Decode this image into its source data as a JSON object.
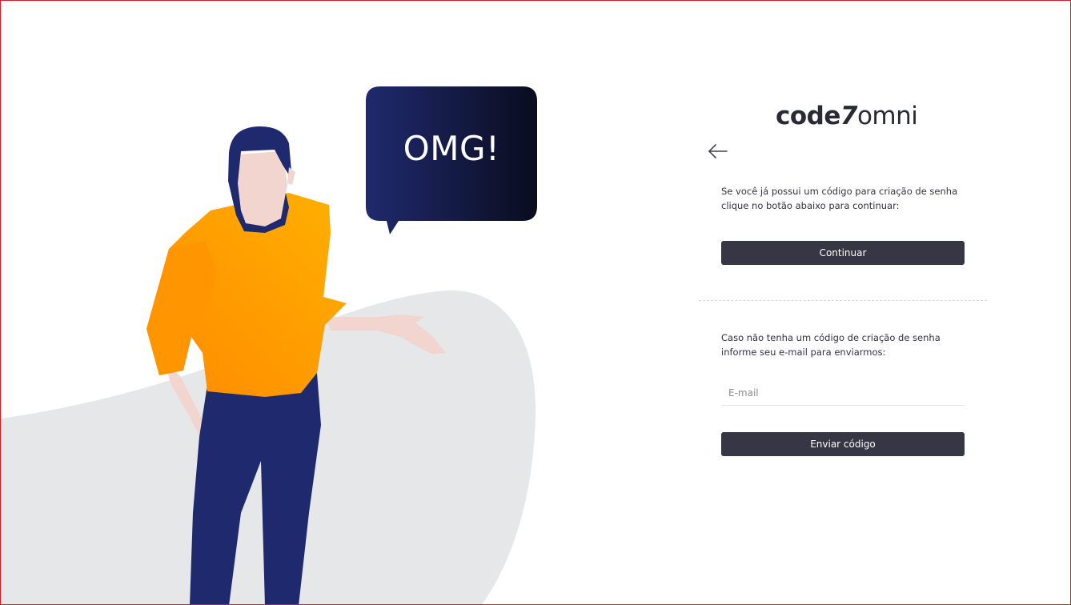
{
  "illustration": {
    "speech_bubble_text": "OMG!"
  },
  "brand": {
    "logo_part1": "code",
    "logo_part2": "7",
    "logo_part3": "omni"
  },
  "colors": {
    "button_bg": "#363644",
    "frame_border": "#d21f2b",
    "shirt": "#ff9a00",
    "pants": "#1f2a6e",
    "blob": "#e6e7e9"
  },
  "back_button": {
    "icon": "arrow-left-icon"
  },
  "existing_code": {
    "text": "Se você já possui um código para criação de senha clique no botão abaixo para continuar:",
    "button_label": "Continuar"
  },
  "request_code": {
    "text": "Caso não tenha um código de criação de senha informe seu e-mail para enviarmos:",
    "email_placeholder": "E-mail",
    "email_value": "",
    "button_label": "Enviar código"
  }
}
